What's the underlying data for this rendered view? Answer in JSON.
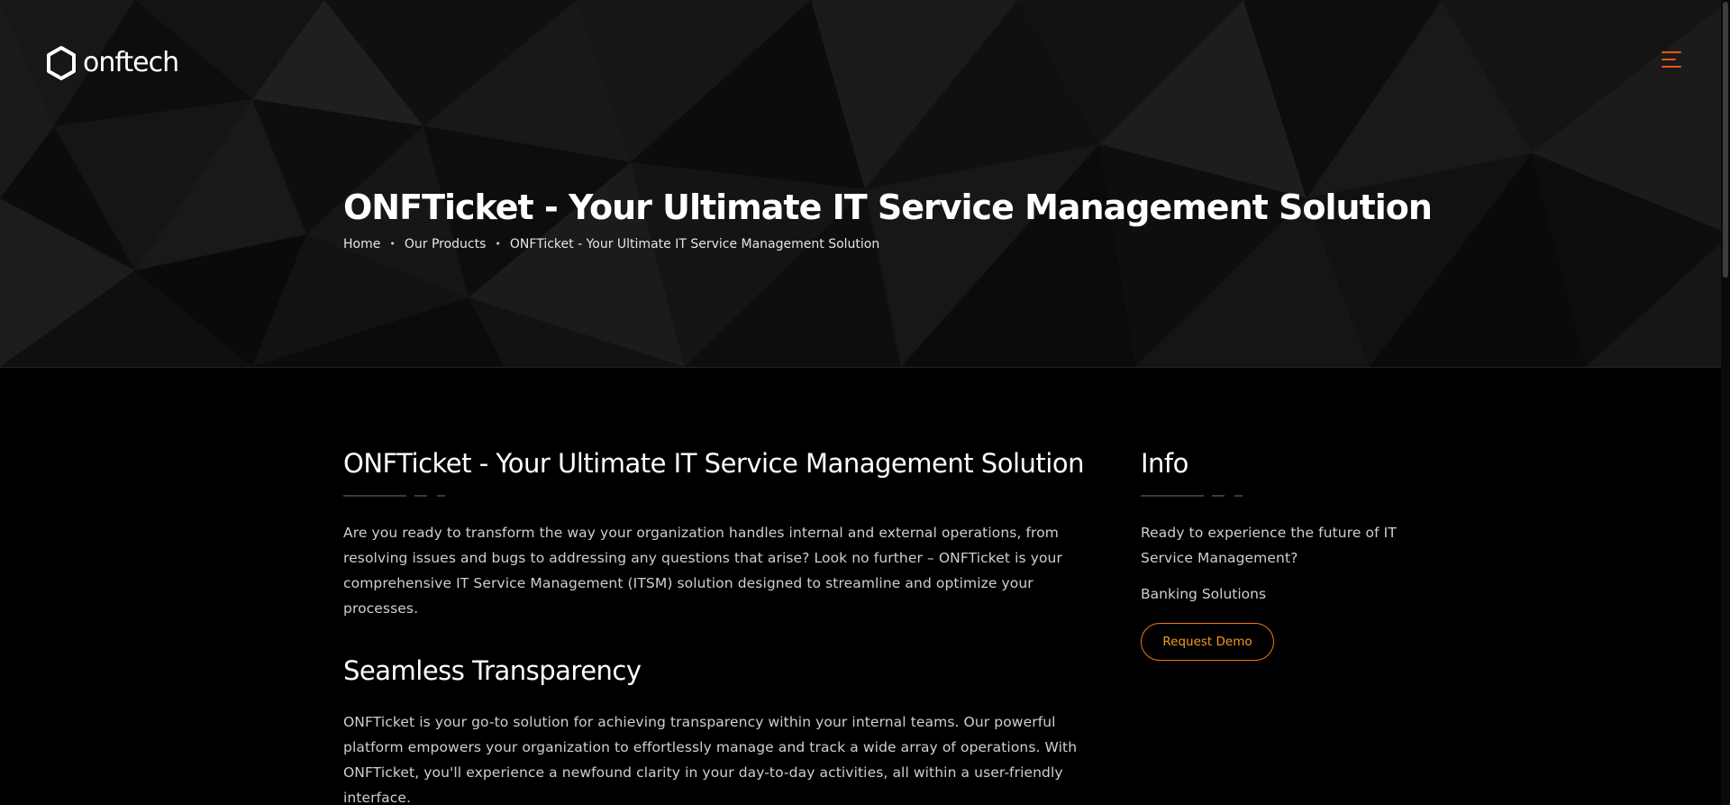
{
  "header": {
    "logo_text": "onftech",
    "menu_icon": "hamburger-menu-icon"
  },
  "hero": {
    "title": "ONFTicket - Your Ultimate IT Service Management Solution",
    "breadcrumb": {
      "home": "Home",
      "products": "Our Products",
      "current": "ONFTicket - Your Ultimate IT Service Management Solution",
      "separator": "•"
    }
  },
  "main": {
    "title": "ONFTicket - Your Ultimate IT Service Management Solution",
    "intro": "Are you ready to transform the way your organization handles internal and external operations, from resolving issues and bugs to addressing any questions that arise? Look no further – ONFTicket is your comprehensive IT Service Management (ITSM) solution designed to streamline and optimize your processes.",
    "section_heading": "Seamless Transparency",
    "section_text": "ONFTicket is your go-to solution for achieving transparency within your internal teams. Our powerful platform empowers your organization to effortlessly manage and track a wide array of operations. With ONFTicket, you'll experience a newfound clarity in your day-to-day activities, all within a user-friendly interface."
  },
  "sidebar": {
    "title": "Info",
    "text": "Ready to experience the future of IT Service Management?",
    "link": "Banking Solutions",
    "button": "Request Demo"
  },
  "colors": {
    "accent": "#e8541e",
    "button_border": "#f07a10",
    "button_text": "#f59a28",
    "background": "#000000"
  }
}
